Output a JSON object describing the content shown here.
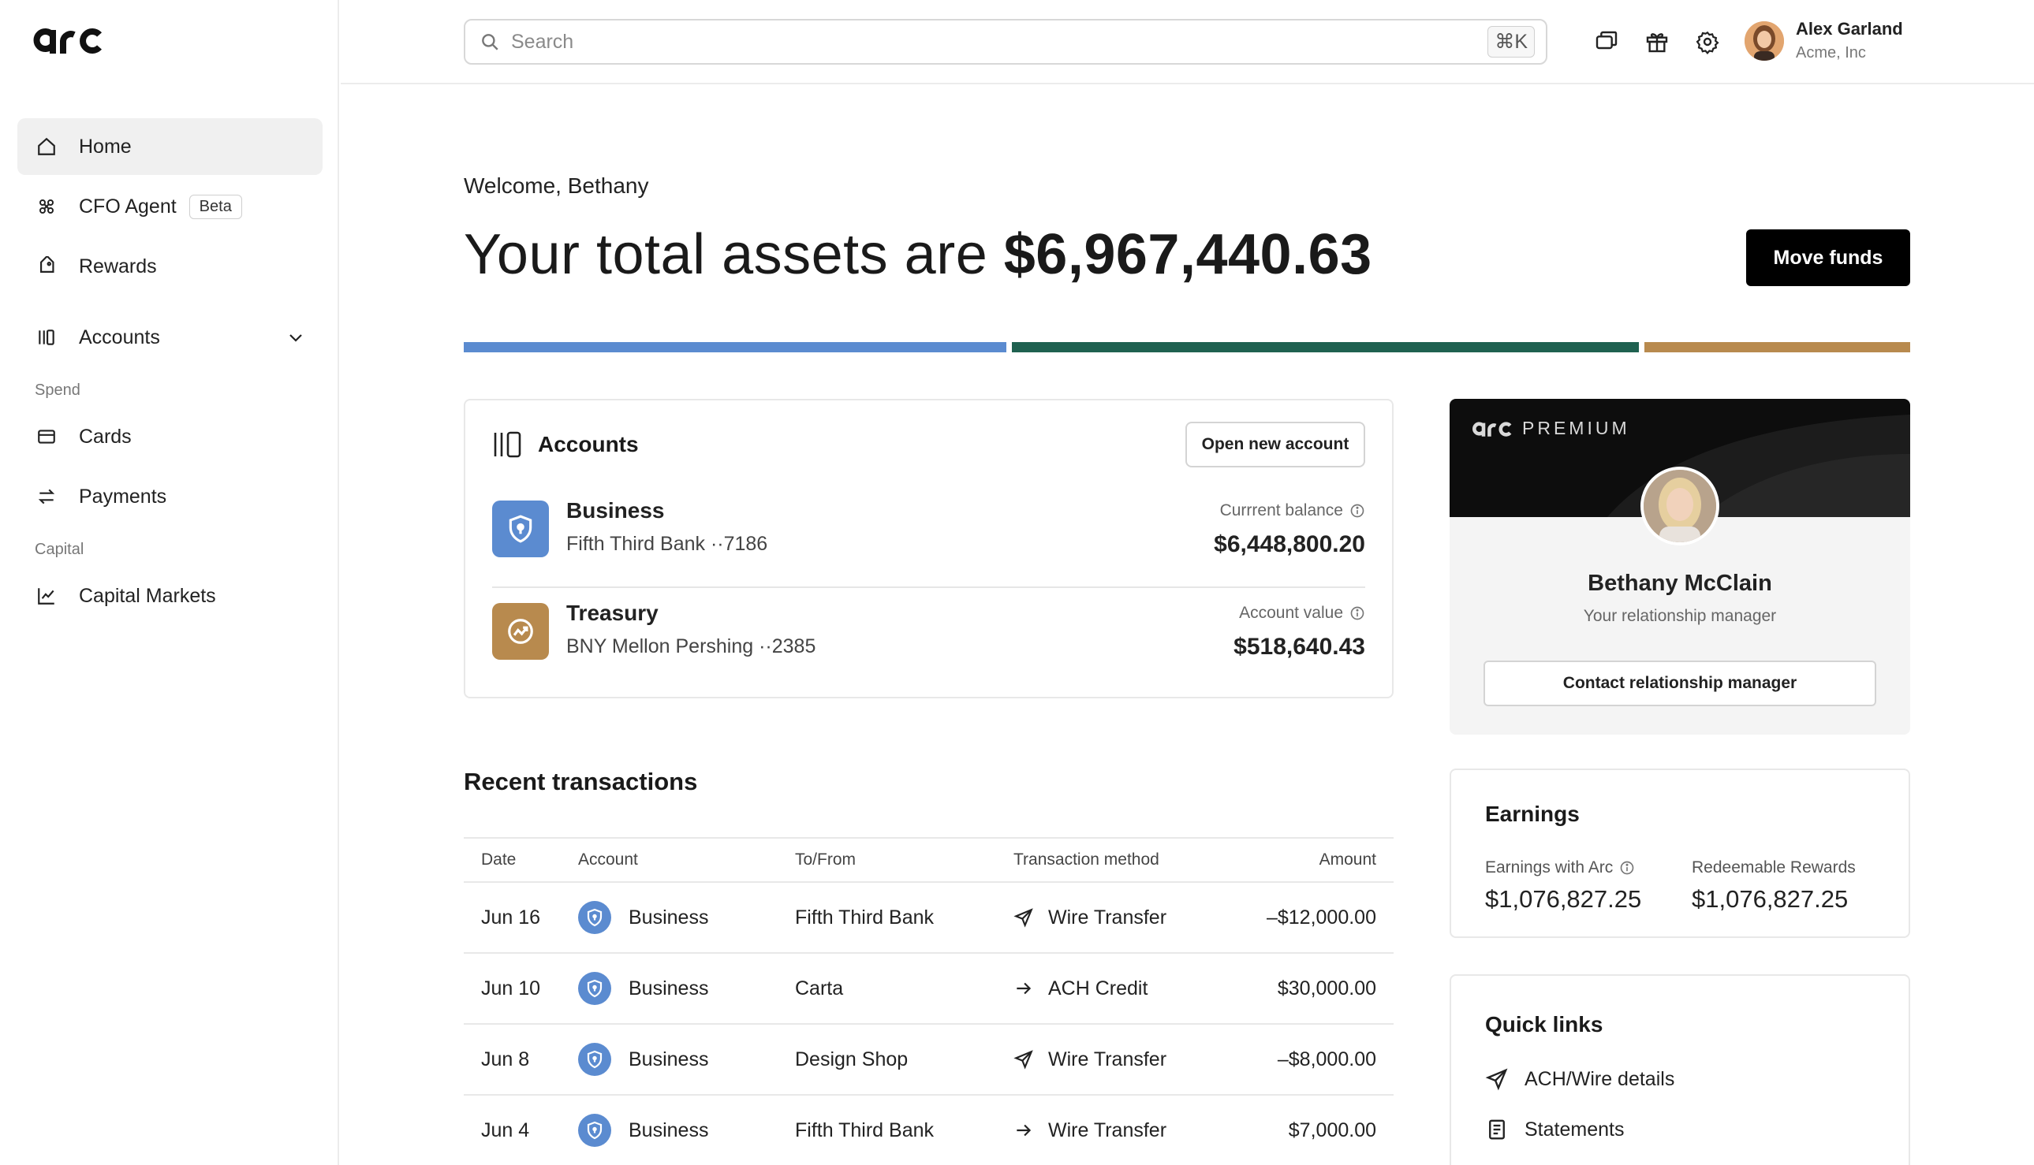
{
  "brand": {
    "logo_text": "arc"
  },
  "search": {
    "placeholder": "Search",
    "shortcut": "⌘K"
  },
  "user": {
    "name": "Alex Garland",
    "org": "Acme, Inc"
  },
  "sidebar": {
    "items": [
      {
        "label": "Home",
        "icon": "home-icon",
        "active": true
      },
      {
        "label": "CFO Agent",
        "icon": "agent-icon",
        "badge": "Beta"
      },
      {
        "label": "Rewards",
        "icon": "tag-icon"
      },
      {
        "label": "Accounts",
        "icon": "accounts-icon"
      }
    ],
    "sections": [
      {
        "title": "Spend",
        "items": [
          {
            "label": "Cards",
            "icon": "card-icon"
          },
          {
            "label": "Payments",
            "icon": "transfer-icon"
          }
        ]
      },
      {
        "title": "Capital",
        "items": [
          {
            "label": "Capital Markets",
            "icon": "chart-line-icon"
          }
        ]
      }
    ]
  },
  "main": {
    "welcome": "Welcome, Bethany",
    "headline_prefix": "Your total assets are",
    "total_assets": "$6,967,440.63",
    "move_funds_label": "Move funds",
    "allocation_colors": [
      "#5b8bd0",
      "#1f6150",
      "#b88a4e"
    ]
  },
  "accounts_card": {
    "title": "Accounts",
    "open_button": "Open new account",
    "rows": [
      {
        "name": "Business",
        "sub": "Fifth Third Bank ··7186",
        "label": "Currrent balance",
        "value": "$6,448,800.20",
        "color": "#5b8bd0",
        "icon": "shield-icon"
      },
      {
        "name": "Treasury",
        "sub": "BNY Mellon Pershing ··2385",
        "label": "Account value",
        "value": "$518,640.43",
        "color": "#b88a4e",
        "icon": "trend-icon"
      }
    ]
  },
  "transactions": {
    "title": "Recent transactions",
    "columns": [
      "Date",
      "Account",
      "To/From",
      "Transaction method",
      "Amount"
    ],
    "rows": [
      {
        "date": "Jun 16",
        "account": "Business",
        "to": "Fifth Third Bank",
        "method": "Wire Transfer",
        "method_icon": "send-icon",
        "amount": "–$12,000.00",
        "positive": false
      },
      {
        "date": "Jun 10",
        "account": "Business",
        "to": "Carta",
        "method": "ACH Credit",
        "method_icon": "arrow-right-icon",
        "amount": "$30,000.00",
        "positive": true
      },
      {
        "date": "Jun 8",
        "account": "Business",
        "to": "Design Shop",
        "method": "Wire Transfer",
        "method_icon": "send-icon",
        "amount": "–$8,000.00",
        "positive": false
      },
      {
        "date": "Jun 4",
        "account": "Business",
        "to": "Fifth Third Bank",
        "method": "Wire Transfer",
        "method_icon": "arrow-right-icon",
        "amount": "$7,000.00",
        "positive": true
      }
    ]
  },
  "premium": {
    "label": "PREMIUM",
    "manager_name": "Bethany McClain",
    "manager_role": "Your relationship manager",
    "contact_button": "Contact relationship manager"
  },
  "earnings": {
    "title": "Earnings",
    "items": [
      {
        "label": "Earnings with Arc",
        "value": "$1,076,827.25"
      },
      {
        "label": "Redeemable Rewards",
        "value": "$1,076,827.25"
      }
    ]
  },
  "quick_links": {
    "title": "Quick links",
    "items": [
      {
        "label": "ACH/Wire details",
        "icon": "send-icon"
      },
      {
        "label": "Statements",
        "icon": "document-icon"
      }
    ]
  }
}
